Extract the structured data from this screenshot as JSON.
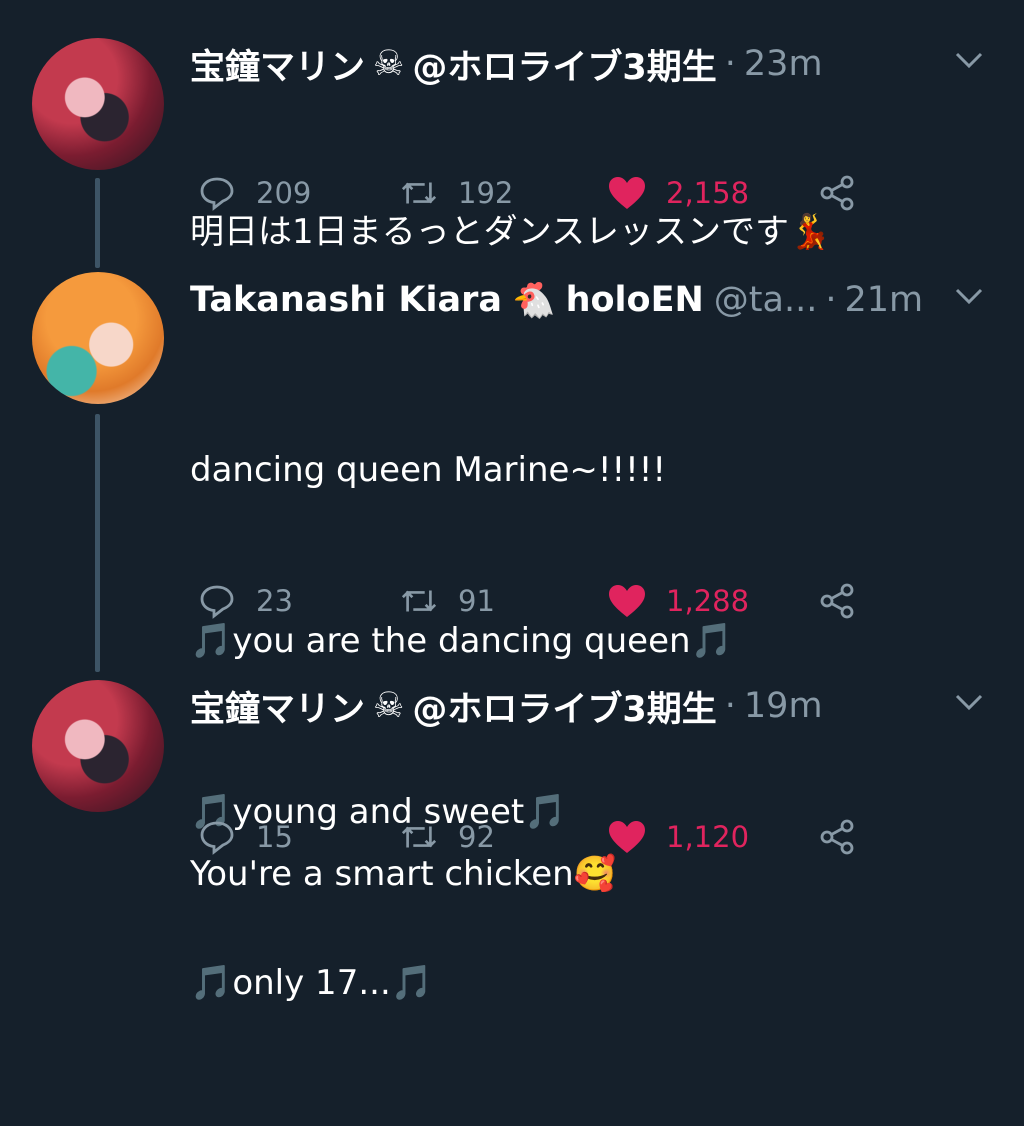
{
  "tweets": [
    {
      "author": "宝鐘マリン",
      "author_emoji": "☠",
      "handle": "@ホロライブ3期生",
      "time": "23m",
      "lines": [
        "明日は1日まるっとダンスレッスンです💃"
      ],
      "replies": "209",
      "retweets": "192",
      "likes": "2,158"
    },
    {
      "author": "Takanashi Kiara",
      "author_emoji": "🐔",
      "author_suffix": "holoEN",
      "handle": "@ta...",
      "time": "21m",
      "lines": [
        "dancing queen Marine~!!!!!",
        "🎵you are the dancing queen🎵",
        "🎵young and sweet🎵",
        "🎵only 17...🎵"
      ],
      "replies": "23",
      "retweets": "91",
      "likes": "1,288"
    },
    {
      "author": "宝鐘マリン",
      "author_emoji": "☠",
      "handle": "@ホロライブ3期生",
      "time": "19m",
      "lines": [
        "You're a smart chicken🥰"
      ],
      "replies": "15",
      "retweets": "92",
      "likes": "1,120"
    }
  ],
  "icons": {
    "reply": "reply-icon",
    "retweet": "retweet-icon",
    "like": "heart-icon",
    "share": "share-icon",
    "caret": "chevron-down-icon"
  },
  "colors": {
    "background": "#15202b",
    "secondary_text": "#8899a6",
    "like": "#e0245e",
    "thread_line": "#3d5466"
  },
  "dot_separator": "·"
}
